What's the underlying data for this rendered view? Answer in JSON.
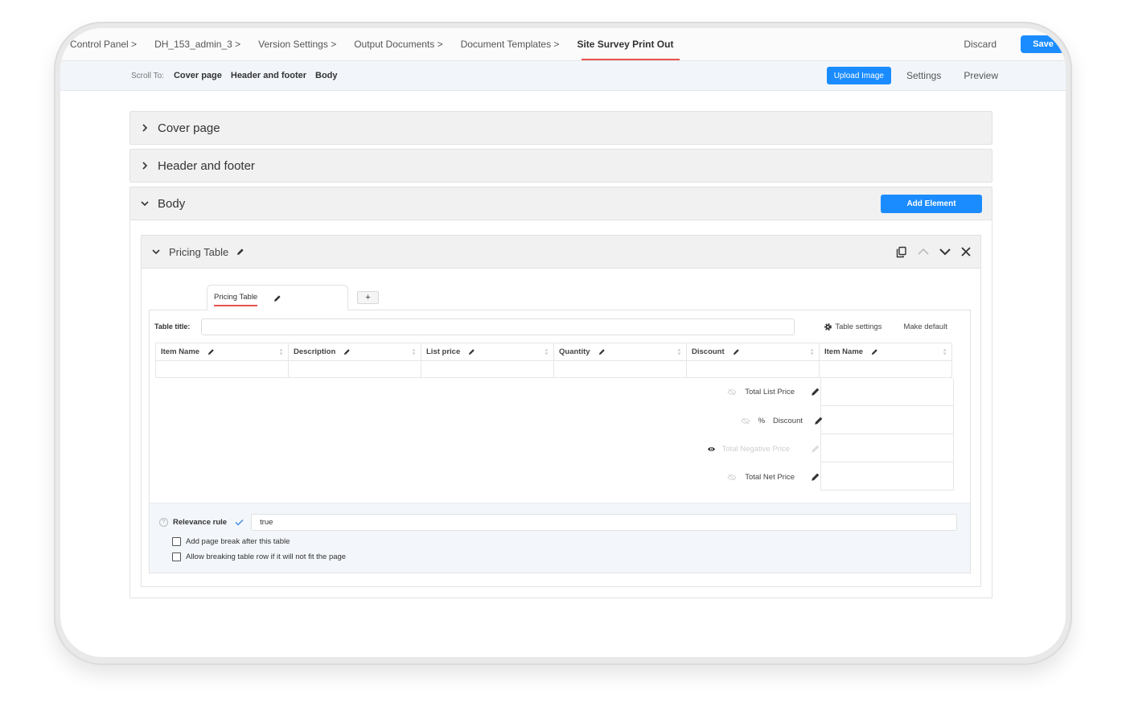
{
  "breadcrumbs": [
    {
      "label": "Control Panel >"
    },
    {
      "label": "DH_153_admin_3 >"
    },
    {
      "label": "Version Settings >"
    },
    {
      "label": "Output Documents >"
    },
    {
      "label": "Document Templates >"
    },
    {
      "label": "Site Survey Print Out",
      "active": true
    }
  ],
  "topnav": {
    "discard_label": "Discard",
    "save_label": "Save"
  },
  "subnav": {
    "scroll_label": "Scroll To:",
    "scroll_links": [
      "Cover page",
      "Header and footer",
      "Body"
    ],
    "upload_label": "Upload Image",
    "settings_label": "Settings",
    "preview_label": "Preview"
  },
  "sections": {
    "cover": "Cover page",
    "header_footer": "Header and footer",
    "body": "Body",
    "add_element_label": "Add Element"
  },
  "pricing_table": {
    "title": "Pricing Table",
    "tab_label": "Pricing Table",
    "add_tab_label": "+",
    "table_title_label": "Table title:",
    "table_title_value": "",
    "table_settings_label": "Table settings",
    "make_default_label": "Make default",
    "columns": [
      "Item Name",
      "Description",
      "List price",
      "Quantity",
      "Discount",
      "Item Name"
    ],
    "totals": [
      {
        "label": "Total List Price",
        "visible": false,
        "enabled": true
      },
      {
        "label": "Discount",
        "prefix": "%",
        "visible": false,
        "enabled": true
      },
      {
        "label": "Total Negative Price",
        "visible": true,
        "enabled": false
      },
      {
        "label": "Total Net Price",
        "visible": false,
        "enabled": true
      }
    ],
    "relevance_label": "Relevance rule",
    "relevance_value": "true",
    "checkboxes": [
      {
        "label": "Add page break after this table",
        "checked": false
      },
      {
        "label": "Allow breaking table row if it will not fit the page",
        "checked": false
      }
    ]
  },
  "colors": {
    "accent": "#1a8cff",
    "active_underline": "#e9524f"
  }
}
